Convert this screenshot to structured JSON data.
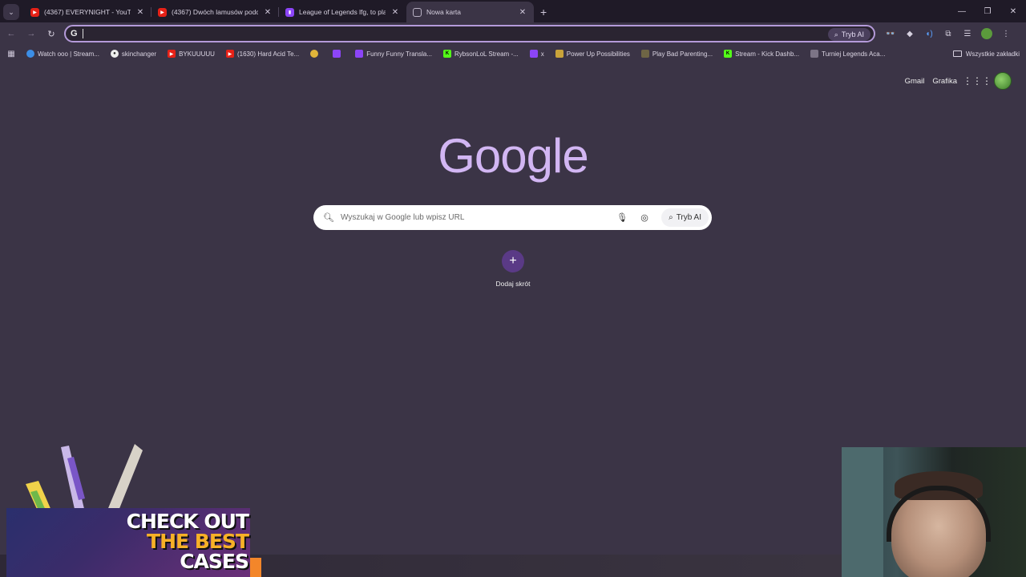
{
  "tabs": [
    {
      "title": "(4367) EVERYNIGHT - YouTube",
      "favicon": "youtube-icon",
      "active": false
    },
    {
      "title": "(4367) Dwóch lamusów podcast",
      "favicon": "youtube-icon",
      "active": false
    },
    {
      "title": "League of Legends lfg, to play",
      "favicon": "twitch-icon",
      "active": false
    },
    {
      "title": "Nowa karta",
      "favicon": "google-icon",
      "active": true
    }
  ],
  "omnibox": {
    "value": "",
    "ai_label": "Tryb AI"
  },
  "bookmarks": [
    {
      "label": "Watch ooo | Stream...",
      "icon": "stream-icon"
    },
    {
      "label": "skinchanger",
      "icon": "github-icon"
    },
    {
      "label": "BYKUUUUU",
      "icon": "youtube-icon"
    },
    {
      "label": "(1630) Hard Acid Te...",
      "icon": "youtube-icon"
    },
    {
      "label": "",
      "icon": "emoji-icon"
    },
    {
      "label": "",
      "icon": "twitch-icon"
    },
    {
      "label": "Funny Funny Transla...",
      "icon": "translate-icon"
    },
    {
      "label": "RybsonLoL Stream -...",
      "icon": "kick-icon"
    },
    {
      "label": "x",
      "icon": "twitch-icon"
    },
    {
      "label": "Power Up Possibilities",
      "icon": "puzzle-icon"
    },
    {
      "label": "Play Bad Parenting...",
      "icon": "game-icon"
    },
    {
      "label": "Stream - Kick Dashb...",
      "icon": "kick-icon"
    },
    {
      "label": "Turniej Legends Aca...",
      "icon": "trophy-icon"
    }
  ],
  "all_bookmarks_label": "Wszystkie zakładki",
  "ntp": {
    "gmail": "Gmail",
    "images": "Grafika",
    "logo": "Google",
    "search_placeholder": "Wyszukaj w Google lub wpisz URL",
    "ai_mode": "Tryb AI",
    "add_shortcut": "Dodaj skrót"
  },
  "promo": {
    "line1": "CHECK OUT",
    "line2": "THE BEST",
    "line3": "CASES"
  },
  "colors": {
    "background": "#3b3446",
    "tabstrip": "#1f1a27",
    "accent": "#b49ad9",
    "logo": "#d2b6f3"
  }
}
